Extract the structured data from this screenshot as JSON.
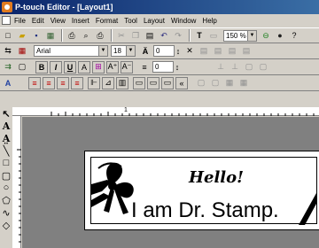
{
  "window": {
    "title": "P-touch Editor - [Layout1]"
  },
  "menu": [
    "File",
    "Edit",
    "View",
    "Insert",
    "Format",
    "Tool",
    "Layout",
    "Window",
    "Help"
  ],
  "toolbar": {
    "zoom_value": "150 %"
  },
  "format": {
    "font_value": "Arial",
    "size_value": "18",
    "spacing_value": "0",
    "linespacing_value": "0"
  },
  "ruler": {
    "unit": "in",
    "mark_1": "1"
  },
  "label": {
    "line1": "Hello!",
    "line2": "I am Dr. Stamp."
  }
}
